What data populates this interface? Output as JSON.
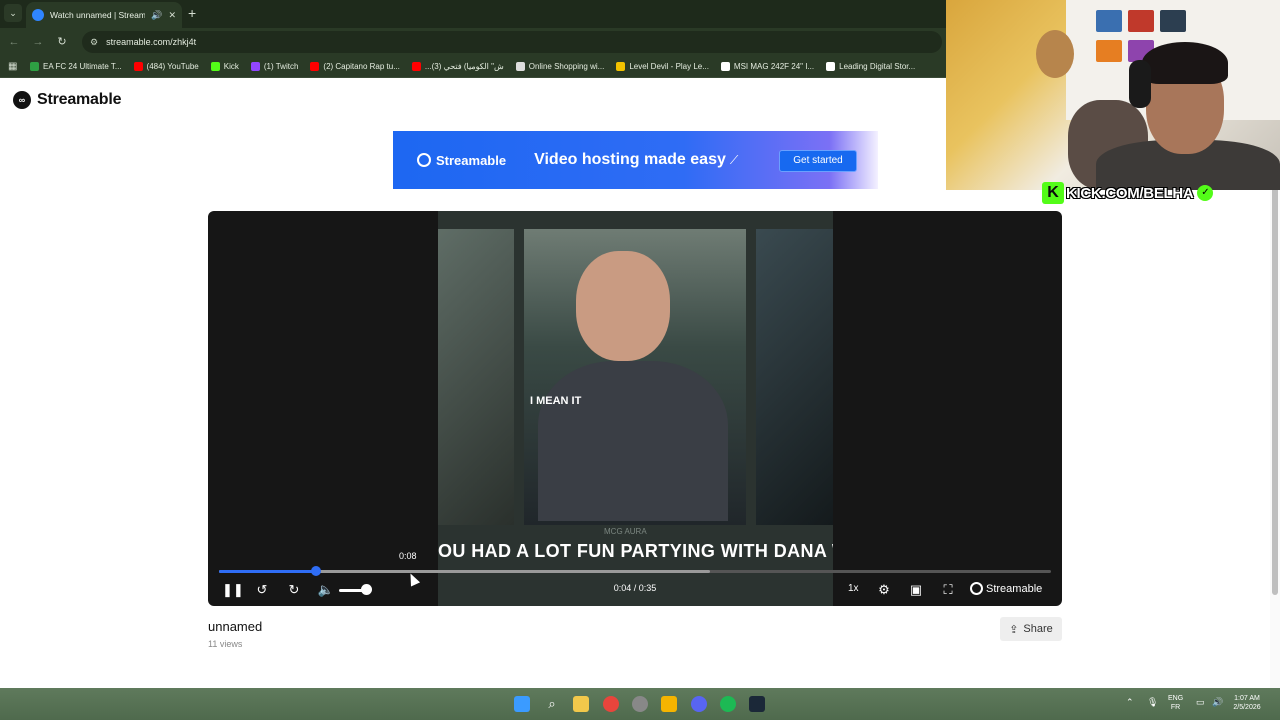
{
  "browser": {
    "tab_title": "Watch unnamed | Streamable",
    "new_tab": "+",
    "url": "streamable.com/zhkj4t",
    "bookmarks": [
      {
        "label": "EA FC 24 Ultimate T...",
        "color": "#2ea043"
      },
      {
        "label": "(484) YouTube",
        "color": "#ff0000"
      },
      {
        "label": "Kick",
        "color": "#53fc18"
      },
      {
        "label": "(1) Twitch",
        "color": "#9146ff"
      },
      {
        "label": "(2) Capitano Rap tu...",
        "color": "#ff0000"
      },
      {
        "label": "...ش\" الكوميا) فتحي (3)",
        "color": "#ff0000"
      },
      {
        "label": "Online Shopping wi...",
        "color": "#dddddd"
      },
      {
        "label": "Level Devil - Play Le...",
        "color": "#f2c200"
      },
      {
        "label": "MSI MAG 242F 24\" I...",
        "color": "#ffffff"
      },
      {
        "label": "Leading Digital Stor...",
        "color": "#ffffff"
      }
    ]
  },
  "site": {
    "logo": "Streamable",
    "banner_brand": "Streamable",
    "banner_text": "Video hosting made easy",
    "banner_cta": "Get started"
  },
  "player": {
    "caption_top": "I MEAN IT",
    "watermark": "MCG AURA",
    "caption_bottom": "OU HAD A LOT FUN PARTYING WITH DANA WI",
    "hover_time": "0:08",
    "time_display": "0:04 / 0:35",
    "speed": "1x",
    "brand": "Streamable",
    "progress": 0.117,
    "buffered": 0.59,
    "volume": 0.85
  },
  "video": {
    "title": "unnamed",
    "views": "11 views",
    "share_label": "Share"
  },
  "overlay": {
    "kick_handle": "KICK.COM/BELHA"
  },
  "taskbar": {
    "lang_top": "ENG",
    "lang_bottom": "FR",
    "time": "1:07 AM",
    "date": "2/5/2026"
  }
}
